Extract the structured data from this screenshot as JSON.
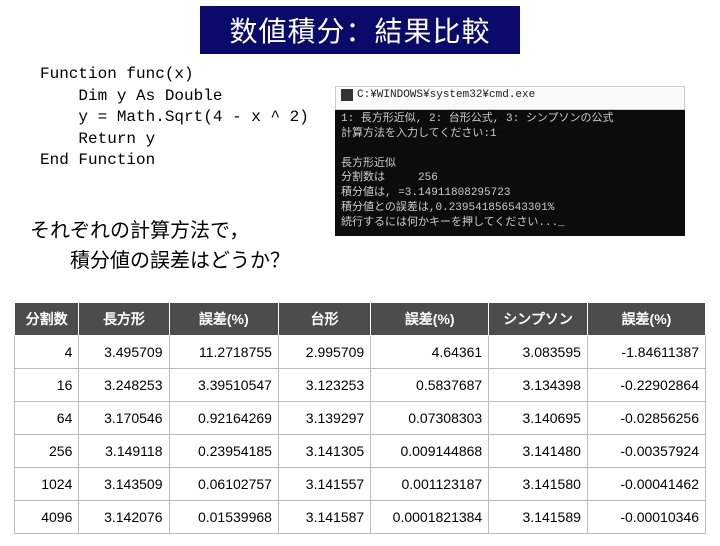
{
  "title": "数値積分：結果比較",
  "code": "Function func(x)\n    Dim y As Double\n    y = Math.Sqrt(4 - x ^ 2)\n    Return y\nEnd Function",
  "console": {
    "window_title": "C:¥WINDOWS¥system32¥cmd.exe",
    "body": "1: 長方形近似, 2: 台形公式, 3: シンプソンの公式\n計算方法を入力してください:1\n\n長方形近似\n分割数は     256\n積分値は, =3.14911808295723\n積分値との誤差は,0.239541856543301%\n続行するには何かキーを押してください..._"
  },
  "question_l1": "それぞれの計算方法で，",
  "question_l2": "　　積分値の誤差はどうか？",
  "headers": {
    "n": "分割数",
    "rect": "長方形",
    "rect_err": "誤差(%)",
    "trap": "台形",
    "trap_err": "誤差(%)",
    "simp": "シンプソン",
    "simp_err": "誤差(%)"
  },
  "rows": [
    {
      "n": "4",
      "rect": "3.495709",
      "rect_err": "11.2718755",
      "trap": "2.995709",
      "trap_err": "4.64361",
      "simp": "3.083595",
      "simp_err": "-1.84611387"
    },
    {
      "n": "16",
      "rect": "3.248253",
      "rect_err": "3.39510547",
      "trap": "3.123253",
      "trap_err": "0.5837687",
      "simp": "3.134398",
      "simp_err": "-0.22902864"
    },
    {
      "n": "64",
      "rect": "3.170546",
      "rect_err": "0.92164269",
      "trap": "3.139297",
      "trap_err": "0.07308303",
      "simp": "3.140695",
      "simp_err": "-0.02856256"
    },
    {
      "n": "256",
      "rect": "3.149118",
      "rect_err": "0.23954185",
      "trap": "3.141305",
      "trap_err": "0.009144868",
      "simp": "3.141480",
      "simp_err": "-0.00357924"
    },
    {
      "n": "1024",
      "rect": "3.143509",
      "rect_err": "0.06102757",
      "trap": "3.141557",
      "trap_err": "0.001123187",
      "simp": "3.141580",
      "simp_err": "-0.00041462"
    },
    {
      "n": "4096",
      "rect": "3.142076",
      "rect_err": "0.01539968",
      "trap": "3.141587",
      "trap_err": "0.0001821384",
      "simp": "3.141589",
      "simp_err": "-0.00010346"
    }
  ]
}
